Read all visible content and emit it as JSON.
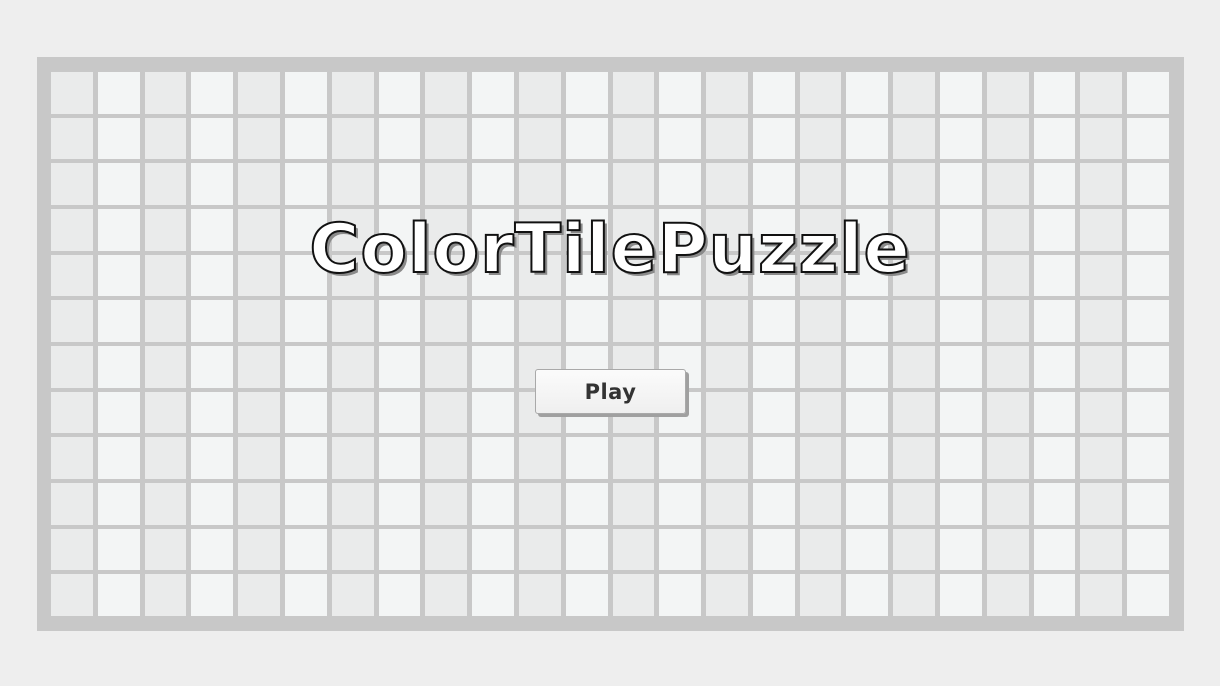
{
  "game": {
    "title": "ColorTilePuzzle",
    "play_label": "Play"
  },
  "board": {
    "columns": 24,
    "rows": 12
  },
  "colors": {
    "background": "#eeeeee",
    "board_frame": "#c8c8c8",
    "tile_light": "#f3f5f5",
    "tile_dark": "#eaebeb",
    "title_fill": "#ffffff",
    "title_outline": "#111111"
  }
}
